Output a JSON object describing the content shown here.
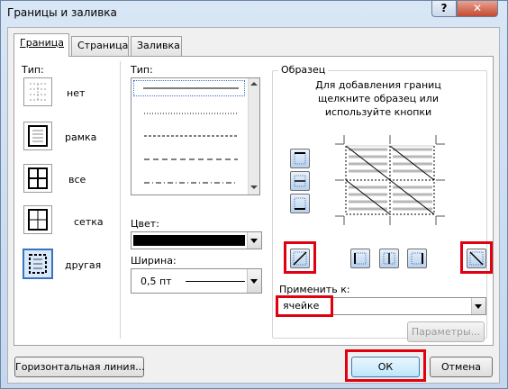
{
  "window": {
    "title": "Границы и заливка",
    "help_glyph": "?",
    "close_glyph": "✕"
  },
  "tabs": [
    {
      "label": "Граница",
      "active": true
    },
    {
      "label": "Страница",
      "active": false
    },
    {
      "label": "Заливка",
      "active": false
    }
  ],
  "settings": {
    "label": "Тип:",
    "items": [
      {
        "label": "нет"
      },
      {
        "label": "рамка"
      },
      {
        "label": "все"
      },
      {
        "label": "сетка"
      },
      {
        "label": "другая",
        "selected": true
      }
    ]
  },
  "style": {
    "label": "Тип:",
    "items": [
      "solid",
      "dotted",
      "dashed",
      "dash",
      "dash-dot"
    ]
  },
  "color": {
    "label": "Цвет:",
    "value": "#000000"
  },
  "width": {
    "label": "Ширина:",
    "value": "0,5 пт"
  },
  "preview": {
    "label": "Образец",
    "hint": "Для добавления границ щелкните образец или используйте кнопки"
  },
  "apply_to": {
    "label": "Применить к:",
    "value": "ячейке"
  },
  "buttons": {
    "params": "Параметры...",
    "horizontal_line": "Горизонтальная линия...",
    "ok": "ОК",
    "cancel": "Отмена"
  },
  "accent": "#e1000f"
}
